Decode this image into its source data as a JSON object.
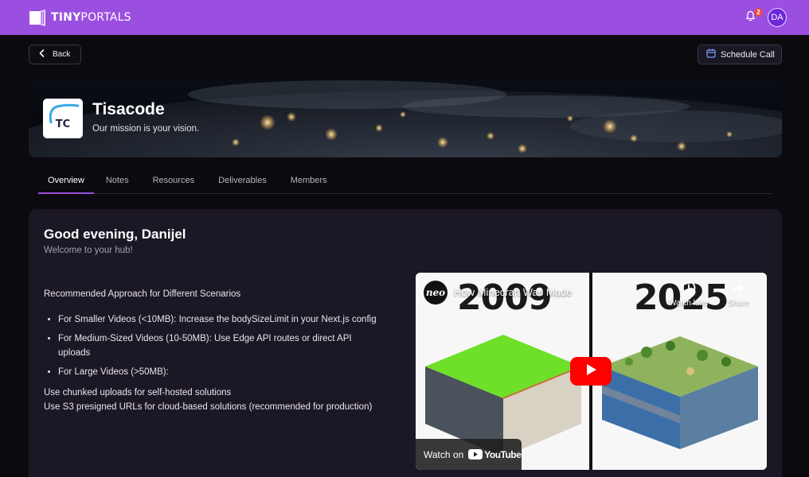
{
  "app": {
    "brand_bold": "TINY",
    "brand_light": "PORTALS"
  },
  "header": {
    "notification_count": "2",
    "avatar_initials": "DA"
  },
  "nav": {
    "back_label": "Back",
    "schedule_label": "Schedule Call"
  },
  "company": {
    "logo_text": "TC",
    "name": "Tisacode",
    "tagline": "Our mission is your vision."
  },
  "tabs": [
    {
      "label": "Overview",
      "active": true
    },
    {
      "label": "Notes"
    },
    {
      "label": "Resources"
    },
    {
      "label": "Deliverables"
    },
    {
      "label": "Members"
    }
  ],
  "main": {
    "greeting": "Good evening, Danijel",
    "welcome": "Welcome to your hub!",
    "heading": "Recommended Approach for Different Scenarios",
    "bullets": [
      "For Smaller Videos (<10MB): Increase the bodySizeLimit in your Next.js config",
      "For Medium-Sized Videos (10-50MB): Use Edge API routes or direct API uploads",
      "For Large Videos (>50MB):"
    ],
    "after_lines": [
      "Use chunked uploads for self-hosted solutions",
      "Use S3 presigned URLs for cloud-based solutions (recommended for production)"
    ]
  },
  "video": {
    "channel": "neo",
    "title": "How Minecraft Was Made",
    "year_left": "2009",
    "year_right": "2025",
    "watch_later": "Watch later",
    "share": "Share",
    "watch_on": "Watch on",
    "youtube": "YouTube"
  },
  "colors": {
    "accent": "#9b4fe0",
    "badge": "#e5484d",
    "youtube_red": "#ff0000"
  },
  "icons": [
    "logo-icon",
    "bell-icon",
    "chevron-left-icon",
    "calendar-icon",
    "play-icon",
    "clock-icon",
    "share-icon"
  ]
}
